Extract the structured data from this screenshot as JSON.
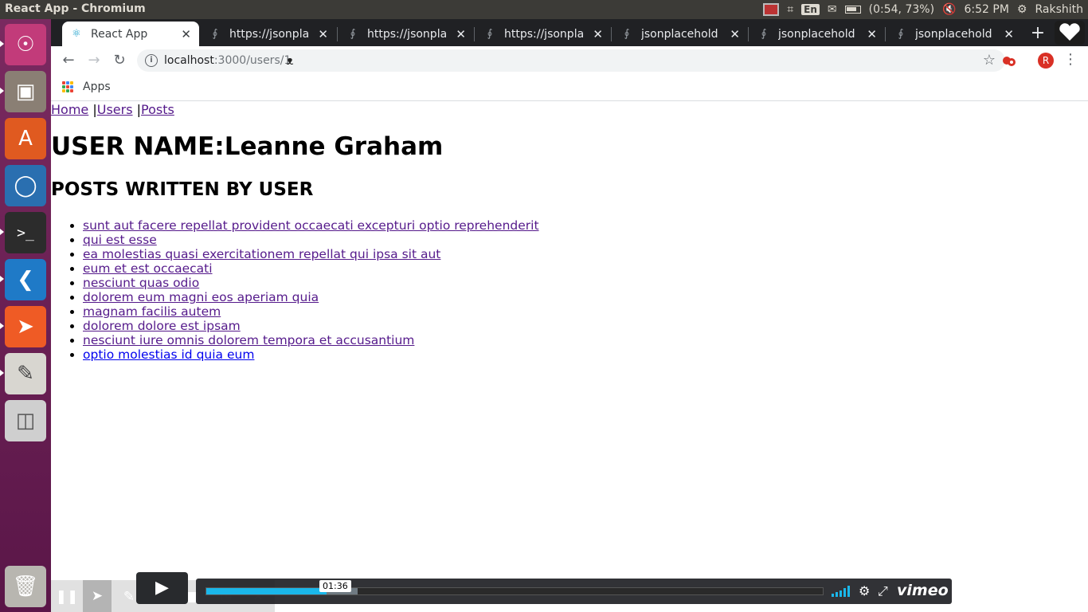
{
  "panel": {
    "title": "React App - Chromium",
    "battery_text": "(0:54, 73%)",
    "keyboard_layout": "En",
    "time": "6:52 PM",
    "user": "Rakshith"
  },
  "launcher": {
    "items": [
      "ubuntu-dash",
      "files",
      "software-center",
      "chromium",
      "terminal",
      "vscode",
      "postman",
      "text-editor",
      "disks",
      "trash"
    ]
  },
  "browser": {
    "tabs": [
      {
        "label": "React App",
        "active": true
      },
      {
        "label": "https://jsonpla",
        "active": false
      },
      {
        "label": "https://jsonpla",
        "active": false
      },
      {
        "label": "https://jsonpla",
        "active": false
      },
      {
        "label": "jsonplacehold",
        "active": false
      },
      {
        "label": "jsonplacehold",
        "active": false
      },
      {
        "label": "jsonplacehold",
        "active": false
      }
    ],
    "url_host": "localhost",
    "url_rest": ":3000/users/1",
    "profile_initial": "R",
    "bookmarks": {
      "apps_label": "Apps"
    }
  },
  "page": {
    "nav": {
      "home": "Home",
      "sep1": " |",
      "users": "Users",
      "sep2": " |",
      "posts": "Posts"
    },
    "title": "USER NAME:Leanne Graham",
    "posts_heading": "POSTS WRITTEN BY USER",
    "posts": [
      "sunt aut facere repellat provident occaecati excepturi optio reprehenderit",
      "qui est esse",
      "ea molestias quasi exercitationem repellat qui ipsa sit aut",
      "eum et est occaecati",
      "nesciunt quas odio",
      "dolorem eum magni eos aperiam quia",
      "magnam facilis autem",
      "dolorem dolore est ipsam",
      "nesciunt iure omnis dolorem tempora et accusantium",
      "optio molestias id quia eum"
    ]
  },
  "video": {
    "timestamp": "01:36",
    "played_fraction": 0.195,
    "buffered_fraction": 0.245,
    "logo": "vimeo",
    "accent": "#1ab7ea"
  }
}
